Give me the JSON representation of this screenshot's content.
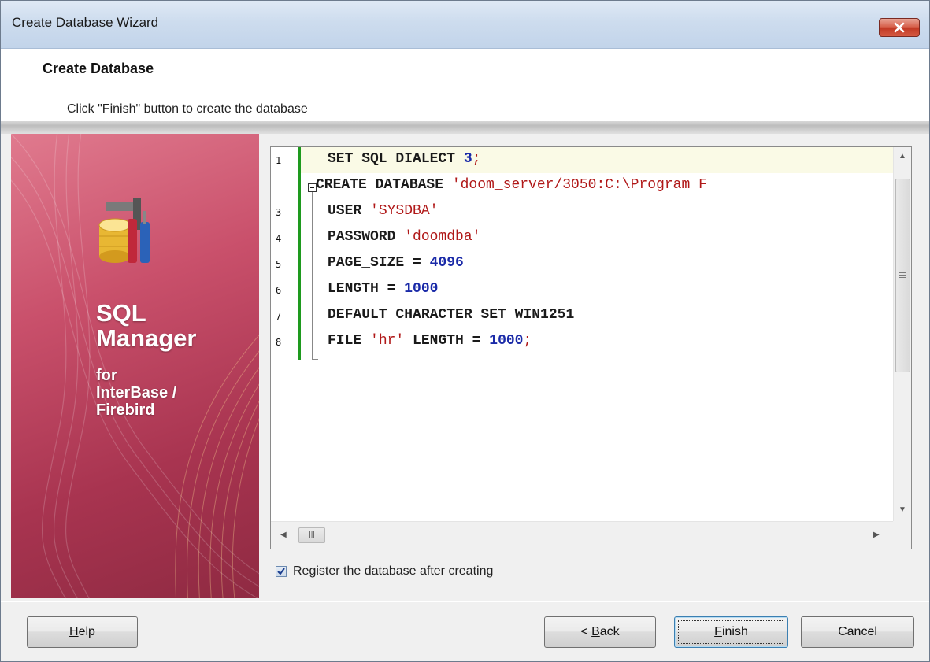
{
  "window": {
    "title": "Create Database Wizard"
  },
  "header": {
    "title": "Create Database",
    "subtitle": "Click \"Finish\" button to create the database"
  },
  "banner": {
    "product_line1": "SQL",
    "product_line2": "Manager",
    "product_sub1": "for",
    "product_sub2": "InterBase /",
    "product_sub3": "Firebird"
  },
  "editor": {
    "lines": [
      {
        "num": "1",
        "parts": [
          [
            "kw",
            "SET SQL DIALECT "
          ],
          [
            "num",
            "3"
          ],
          [
            "str",
            ";"
          ]
        ]
      },
      {
        "num": "",
        "parts": [
          [
            "kw",
            "CREATE DATABASE "
          ],
          [
            "str",
            "'doom_server/3050:C:\\Program F"
          ]
        ]
      },
      {
        "num": "3",
        "parts": [
          [
            "kw",
            "USER "
          ],
          [
            "str",
            "'SYSDBA'"
          ]
        ]
      },
      {
        "num": "4",
        "parts": [
          [
            "kw",
            "PASSWORD "
          ],
          [
            "str",
            "'doomdba'"
          ]
        ]
      },
      {
        "num": "5",
        "parts": [
          [
            "kw",
            "PAGE_SIZE = "
          ],
          [
            "num",
            "4096"
          ]
        ]
      },
      {
        "num": "6",
        "parts": [
          [
            "kw",
            "LENGTH = "
          ],
          [
            "num",
            "1000"
          ]
        ]
      },
      {
        "num": "7",
        "parts": [
          [
            "kw",
            "DEFAULT CHARACTER SET WIN1251"
          ]
        ]
      },
      {
        "num": "8",
        "parts": [
          [
            "kw",
            "FILE "
          ],
          [
            "str",
            "'hr'"
          ],
          [
            "kw",
            " LENGTH = "
          ],
          [
            "num",
            "1000"
          ],
          [
            "str",
            ";"
          ]
        ]
      }
    ]
  },
  "options": {
    "register_label": "Register the database after creating",
    "register_checked": true
  },
  "buttons": {
    "help": {
      "accel": "H",
      "rest": "elp"
    },
    "back": {
      "prefix": "< ",
      "accel": "B",
      "rest": "ack"
    },
    "finish": {
      "accel": "F",
      "rest": "inish"
    },
    "cancel": "Cancel"
  },
  "colors": {
    "keyword": "#1a1a1a",
    "string": "#b01818",
    "number": "#1a2aa8",
    "change_bar": "#1e9a1e"
  }
}
